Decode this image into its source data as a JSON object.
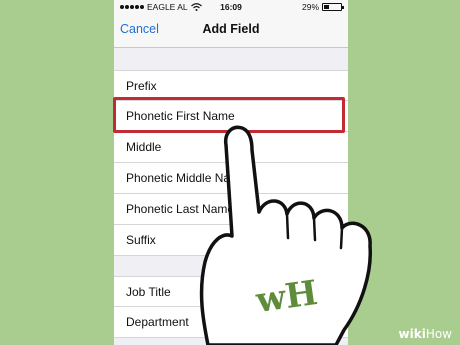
{
  "status": {
    "carrier": "EAGLE AL",
    "time": "16:09",
    "battery": "29%",
    "battery_level": 0.29
  },
  "nav": {
    "cancel_label": "Cancel",
    "title": "Add Field"
  },
  "group1": [
    "Prefix",
    "Phonetic First Name",
    "Middle",
    "Phonetic Middle Name",
    "Phonetic Last Name",
    "Suffix"
  ],
  "group2": [
    "Job Title",
    "Department"
  ],
  "badge": {
    "text": "wH"
  },
  "watermark": {
    "wiki": "wiki",
    "how": "How"
  },
  "colors": {
    "background": "#a9cc8f",
    "accent": "#1f6fd6",
    "highlight": "#c22b33"
  }
}
